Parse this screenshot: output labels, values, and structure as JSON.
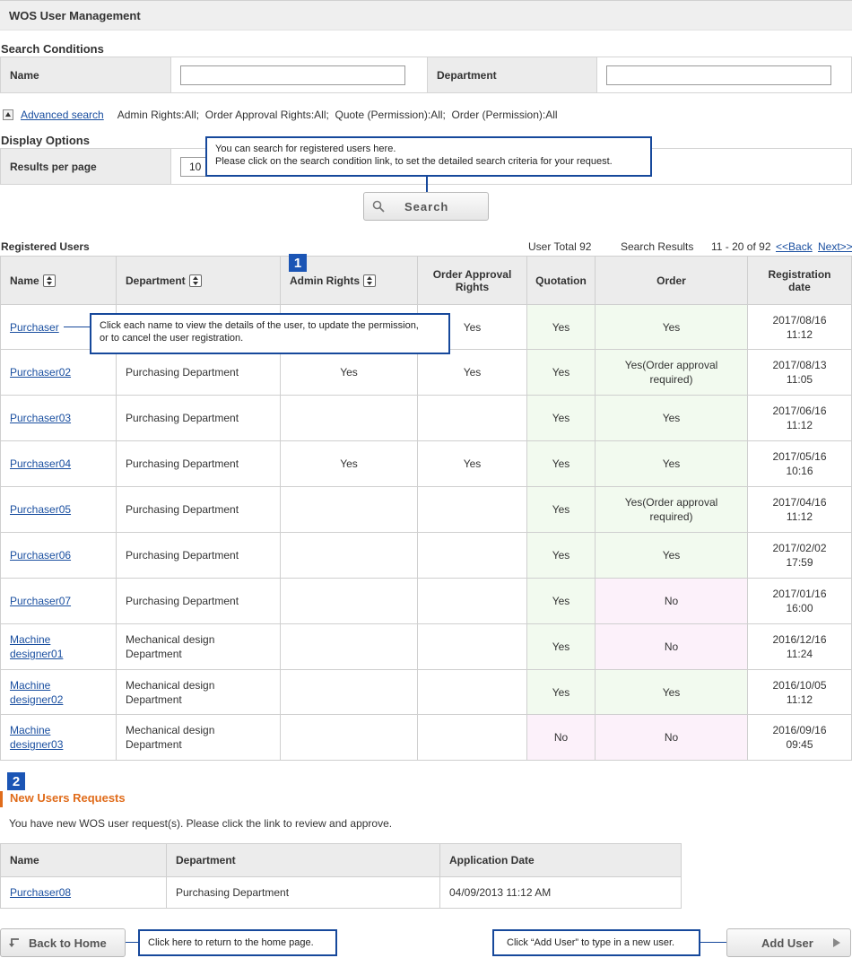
{
  "header": {
    "title": "WOS User Management"
  },
  "search": {
    "section_title": "Search Conditions",
    "name_label": "Name",
    "department_label": "Department",
    "name_value": "",
    "department_value": "",
    "advanced_link": "Advanced search",
    "advanced_summary": "Admin Rights:All;  Order Approval Rights:All;  Quote (Permission):All;  Order (Permission):All"
  },
  "display_options": {
    "section_title": "Display Options",
    "results_label": "Results per page",
    "results_value": "10"
  },
  "search_button": {
    "label": "Search"
  },
  "callouts": {
    "search": "You can search for registered users here.\nPlease click on the search condition link, to set the detailed search criteria for your request.",
    "name": "Click each name to view the details of the user, to update the permission,\nor to cancel the user registration.",
    "home": "Click here to return to the home page.",
    "add_user": "Click “Add User” to type in a new user."
  },
  "registered": {
    "section_title": "Registered Users",
    "user_total": "User Total 92",
    "search_results": "Search Results",
    "range": "11 - 20 of 92",
    "back": "<<Back",
    "next": "Next>>",
    "badge": "1",
    "columns": [
      "Name",
      "Department",
      "Admin Rights",
      "Order Approval Rights",
      "Quotation",
      "Order",
      "Registration date"
    ],
    "rows": [
      {
        "name": "Purchaser",
        "department": "",
        "admin": "",
        "approval": "Yes",
        "quotation": "Yes",
        "order": "Yes",
        "date": "2017/08/16\n11:12"
      },
      {
        "name": "Purchaser02",
        "department": "Purchasing Department",
        "admin": "Yes",
        "approval": "Yes",
        "quotation": "Yes",
        "order": "Yes(Order approval\nrequired)",
        "date": "2017/08/13\n11:05"
      },
      {
        "name": "Purchaser03",
        "department": "Purchasing Department",
        "admin": "",
        "approval": "",
        "quotation": "Yes",
        "order": "Yes",
        "date": "2017/06/16\n11:12"
      },
      {
        "name": "Purchaser04",
        "department": "Purchasing Department",
        "admin": "Yes",
        "approval": "Yes",
        "quotation": "Yes",
        "order": "Yes",
        "date": "2017/05/16\n10:16"
      },
      {
        "name": "Purchaser05",
        "department": "Purchasing Department",
        "admin": "",
        "approval": "",
        "quotation": "Yes",
        "order": "Yes(Order approval\nrequired)",
        "date": "2017/04/16\n11:12"
      },
      {
        "name": "Purchaser06",
        "department": "Purchasing Department",
        "admin": "",
        "approval": "",
        "quotation": "Yes",
        "order": "Yes",
        "date": "2017/02/02\n17:59"
      },
      {
        "name": "Purchaser07",
        "department": "Purchasing Department",
        "admin": "",
        "approval": "",
        "quotation": "Yes",
        "order": "No",
        "date": "2017/01/16\n16:00"
      },
      {
        "name": "Machine\ndesigner01",
        "department": "Mechanical design\nDepartment",
        "admin": "",
        "approval": "",
        "quotation": "Yes",
        "order": "No",
        "date": "2016/12/16\n11:24"
      },
      {
        "name": "Machine\ndesigner02",
        "department": "Mechanical design\nDepartment",
        "admin": "",
        "approval": "",
        "quotation": "Yes",
        "order": "Yes",
        "date": "2016/10/05\n11:12"
      },
      {
        "name": "Machine\ndesigner03",
        "department": "Mechanical design\nDepartment",
        "admin": "",
        "approval": "",
        "quotation": "No",
        "order": "No",
        "date": "2016/09/16\n09:45"
      }
    ]
  },
  "new_requests": {
    "badge": "2",
    "title": "New Users Requests",
    "description": "You have new WOS user request(s). Please click the link to review and approve.",
    "columns": [
      "Name",
      "Department",
      "Application Date"
    ],
    "rows": [
      {
        "name": "Purchaser08",
        "department": "Purchasing Department",
        "date": "04/09/2013 11:12 AM"
      }
    ]
  },
  "footer": {
    "back_label": "Back to Home",
    "add_label": "Add User"
  },
  "colors": {
    "accent_orange": "#e06c1b",
    "callout_blue": "#16489b",
    "yes_bg": "#f2faef",
    "no_bg": "#fcf1fa",
    "link": "#1a4fa0"
  }
}
